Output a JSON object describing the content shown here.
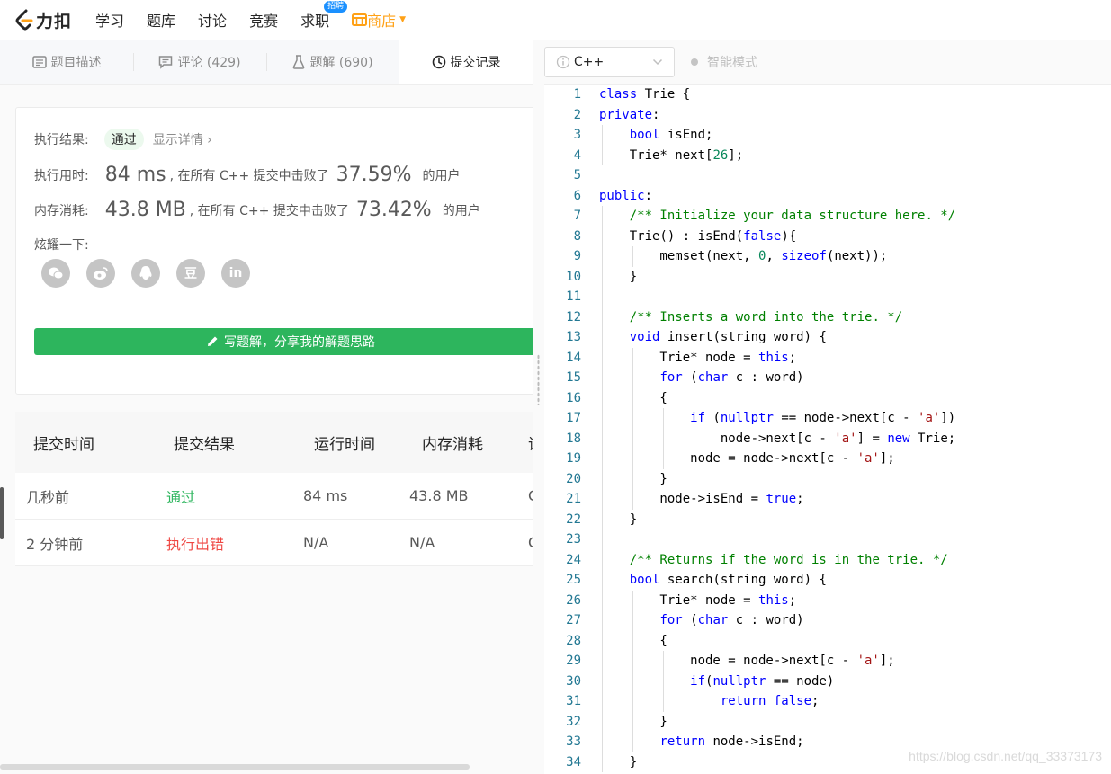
{
  "nav": {
    "logo_text": "力扣",
    "items": [
      "学习",
      "题库",
      "讨论",
      "竞赛",
      "求职"
    ],
    "hire_badge": "招聘",
    "shop": "商店",
    "accent": "#ffa116"
  },
  "tabs": [
    {
      "label": "题目描述",
      "icon": "document-icon"
    },
    {
      "label": "评论 (429)",
      "icon": "comment-icon"
    },
    {
      "label": "题解 (690)",
      "icon": "flask-icon"
    },
    {
      "label": "提交记录",
      "icon": "clock-icon"
    }
  ],
  "result": {
    "status_label": "执行结果:",
    "status": "通过",
    "details_link": "显示详情 ›",
    "runtime_label": "执行用时:",
    "runtime": "84 ms",
    "runtime_text": ", 在所有 C++ 提交中击败了",
    "runtime_pct": "37.59%",
    "users_suffix": "的用户",
    "memory_label": "内存消耗:",
    "memory": "43.8 MB",
    "memory_text": ", 在所有 C++ 提交中击败了",
    "memory_pct": "73.42%",
    "share_label": "炫耀一下:",
    "share_icons": [
      "wechat-icon",
      "weibo-icon",
      "qq-icon",
      "douban-icon",
      "linkedin-icon"
    ],
    "douban_glyph": "豆",
    "linkedin_glyph": "in",
    "write_button": "写题解，分享我的解题思路",
    "success_color": "#2db55d"
  },
  "submissions": {
    "headers": [
      "提交时间",
      "提交结果",
      "运行时间",
      "内存消耗",
      "语"
    ],
    "rows": [
      {
        "time": "几秒前",
        "result": "通过",
        "runtime": "84 ms",
        "memory": "43.8 MB",
        "lang": "C"
      },
      {
        "time": "2 分钟前",
        "result": "执行出错",
        "runtime": "N/A",
        "memory": "N/A",
        "lang": "C"
      }
    ]
  },
  "editor": {
    "language": "C++",
    "mode": "智能模式"
  },
  "watermark": "https://blog.csdn.net/qq_33373173"
}
